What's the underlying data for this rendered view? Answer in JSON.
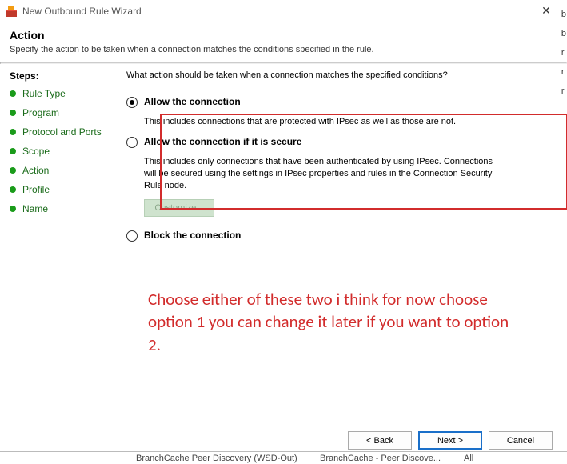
{
  "window": {
    "title": "New Outbound Rule Wizard",
    "close_glyph": "✕"
  },
  "header": {
    "title": "Action",
    "subtitle": "Specify the action to be taken when a connection matches the conditions specified in the rule."
  },
  "steps": {
    "heading": "Steps:",
    "items": [
      {
        "label": "Rule Type"
      },
      {
        "label": "Program"
      },
      {
        "label": "Protocol and Ports"
      },
      {
        "label": "Scope"
      },
      {
        "label": "Action"
      },
      {
        "label": "Profile"
      },
      {
        "label": "Name"
      }
    ]
  },
  "main": {
    "prompt": "What action should be taken when a connection matches the specified conditions?",
    "options": [
      {
        "label": "Allow the connection",
        "desc": "This includes connections that are protected with IPsec as well as those are not.",
        "selected": true
      },
      {
        "label": "Allow the connection if it is secure",
        "desc": "This includes only connections that have been authenticated by using IPsec.  Connections will be secured using the settings in IPsec properties and rules in the Connection Security Rule node.",
        "selected": false
      },
      {
        "label": "Block the connection",
        "desc": "",
        "selected": false
      }
    ],
    "customize_label": "Customize..."
  },
  "annotation": {
    "text": "Choose either of these two i think for now choose option 1 you can change it later if you want to option 2."
  },
  "footer": {
    "back": "< Back",
    "next": "Next >",
    "cancel": "Cancel"
  },
  "edge": {
    "l1": "b",
    "l2": "b",
    "l3": "r",
    "l4": "r",
    "l5": "r"
  },
  "bottom": {
    "c1": "BranchCache Peer Discovery (WSD-Out)",
    "c2": "BranchCache - Peer Discove...",
    "c3": "All"
  }
}
